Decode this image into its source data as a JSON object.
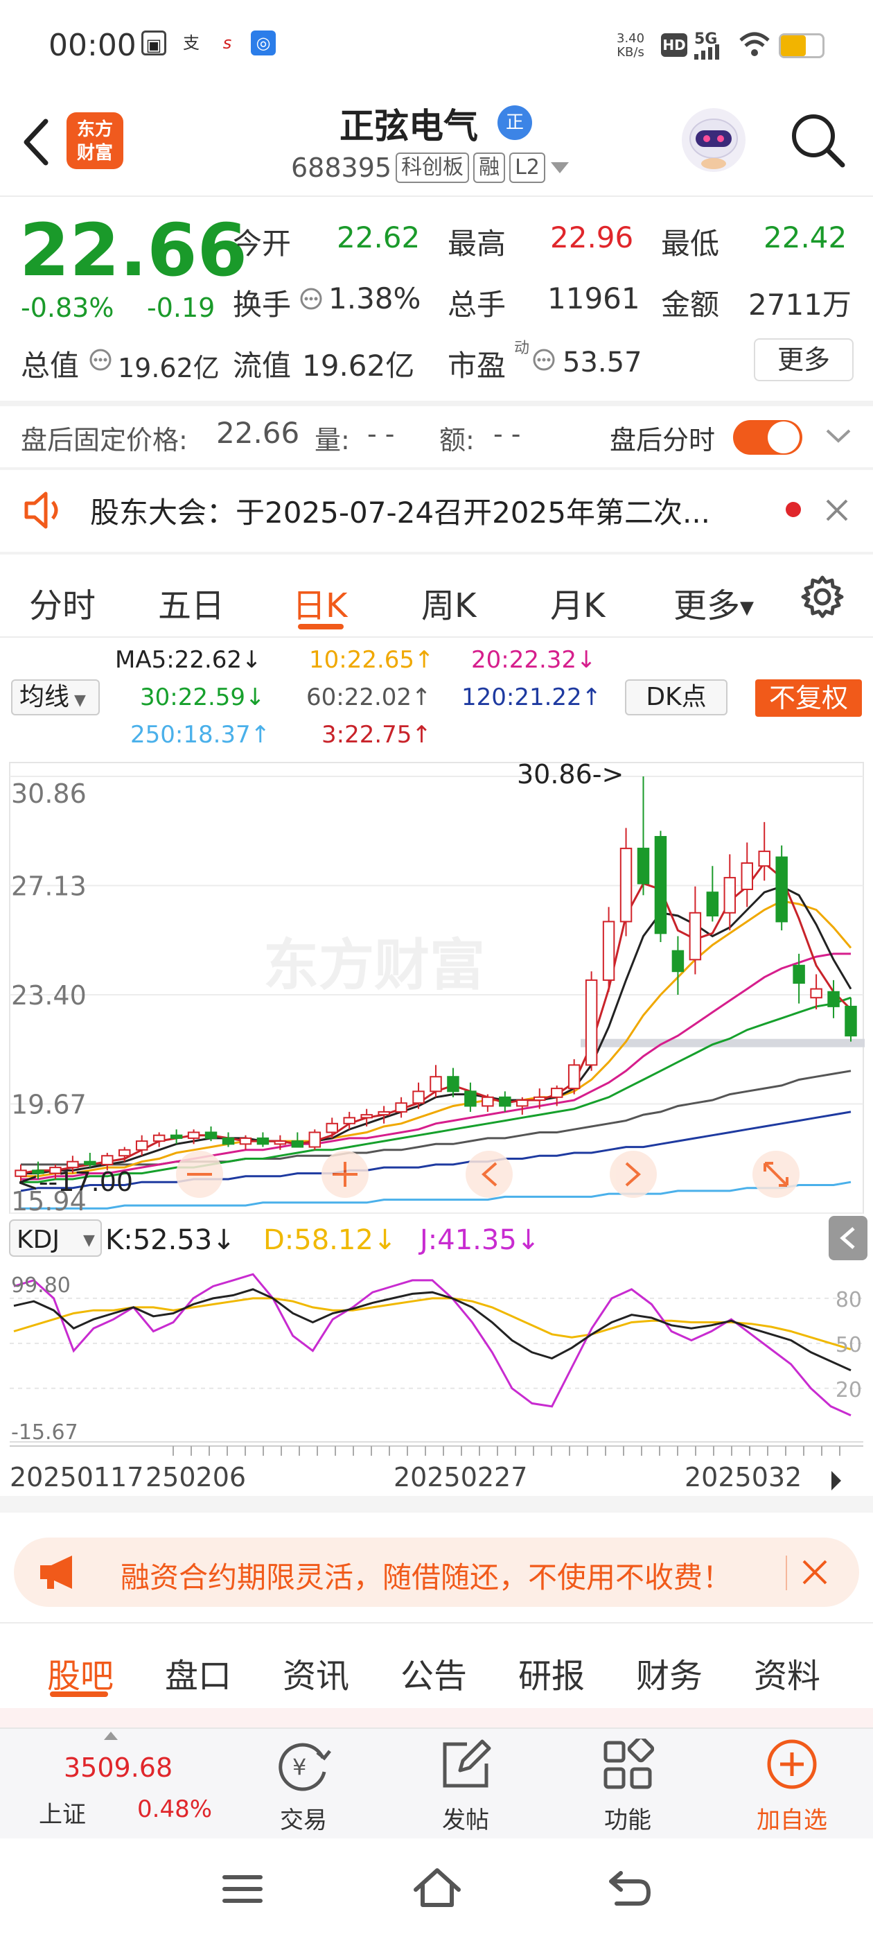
{
  "status_bar": {
    "time": "00:00",
    "net_speed": "3.40",
    "net_speed_unit": "KB/s",
    "network": "5G",
    "icons": [
      "hd-icon",
      "signal-icon",
      "wifi-icon",
      "battery-icon"
    ]
  },
  "header": {
    "logo_line1": "东方",
    "logo_line2": "财富",
    "stock_name": "正弦电气",
    "name_badge": "正",
    "stock_code": "688395",
    "tags": [
      "科创板",
      "融",
      "L2"
    ]
  },
  "quote": {
    "price": "22.66",
    "change_pct": "-0.83%",
    "change_abs": "-0.19",
    "open_label": "今开",
    "open": "22.62",
    "high_label": "最高",
    "high": "22.96",
    "low_label": "最低",
    "low": "22.42",
    "turnover_label": "换手",
    "turnover": "1.38%",
    "volume_label": "总手",
    "volume": "11961",
    "amount_label": "金额",
    "amount": "2711万",
    "mktcap_label": "总值",
    "mktcap": "19.62亿",
    "float_label": "流值",
    "float_cap": "19.62亿",
    "pe_label": "市盈",
    "pe_sup": "动",
    "pe": "53.57",
    "more_label": "更多"
  },
  "after_hours": {
    "label": "盘后固定价格:",
    "price": "22.66",
    "vol_label": "量:",
    "vol": "- -",
    "amt_label": "额:",
    "amt": "- -",
    "toggle_label": "盘后分时",
    "toggle_on": true
  },
  "notice": {
    "text": "股东大会：于2025-07-24召开2025年第二次..."
  },
  "period_tabs": [
    "分时",
    "五日",
    "日K",
    "周K",
    "月K",
    "更多"
  ],
  "ma_legend": {
    "select_label": "均线",
    "ma5": "MA5:22.62↓",
    "ma10": "10:22.65↑",
    "ma20": "20:22.32↓",
    "ma30": "30:22.59↓",
    "ma60": "60:22.02↑",
    "ma120": "120:21.22↑",
    "ma250": "250:18.37↑",
    "ma3": "3:22.75↑",
    "dk_label": "DK点",
    "fq_label": "不复权",
    "colors": {
      "ma5": "#222222",
      "ma10": "#f0a800",
      "ma20": "#d61e8c",
      "ma30": "#16a02c",
      "ma60": "#555555",
      "ma120": "#1e3aa0",
      "ma250": "#4ab0ea",
      "ma3": "#c8232a"
    }
  },
  "chart_data": {
    "type": "candlestick",
    "ylim": [
      15.94,
      30.86
    ],
    "y_ticks": [
      "30.86",
      "27.13",
      "23.40",
      "19.67",
      "15.94"
    ],
    "high_label": "30.86->",
    "low_label": "<--17.00",
    "watermark": "东方财富",
    "candles": [
      {
        "o": 17.2,
        "h": 17.6,
        "l": 17.0,
        "c": 17.4
      },
      {
        "o": 17.4,
        "h": 17.7,
        "l": 17.1,
        "c": 17.3
      },
      {
        "o": 17.3,
        "h": 17.6,
        "l": 17.1,
        "c": 17.5
      },
      {
        "o": 17.5,
        "h": 17.9,
        "l": 17.3,
        "c": 17.7
      },
      {
        "o": 17.7,
        "h": 18.0,
        "l": 17.5,
        "c": 17.6
      },
      {
        "o": 17.6,
        "h": 18.0,
        "l": 17.4,
        "c": 17.9
      },
      {
        "o": 17.9,
        "h": 18.2,
        "l": 17.7,
        "c": 18.1
      },
      {
        "o": 18.1,
        "h": 18.6,
        "l": 17.9,
        "c": 18.4
      },
      {
        "o": 18.4,
        "h": 18.7,
        "l": 18.2,
        "c": 18.6
      },
      {
        "o": 18.6,
        "h": 18.8,
        "l": 18.3,
        "c": 18.5
      },
      {
        "o": 18.5,
        "h": 18.8,
        "l": 18.3,
        "c": 18.7
      },
      {
        "o": 18.7,
        "h": 18.9,
        "l": 18.4,
        "c": 18.5
      },
      {
        "o": 18.5,
        "h": 18.7,
        "l": 18.2,
        "c": 18.3
      },
      {
        "o": 18.3,
        "h": 18.6,
        "l": 18.1,
        "c": 18.5
      },
      {
        "o": 18.5,
        "h": 18.7,
        "l": 18.2,
        "c": 18.3
      },
      {
        "o": 18.3,
        "h": 18.6,
        "l": 18.1,
        "c": 18.4
      },
      {
        "o": 18.4,
        "h": 18.7,
        "l": 18.2,
        "c": 18.2
      },
      {
        "o": 18.2,
        "h": 18.8,
        "l": 18.1,
        "c": 18.7
      },
      {
        "o": 18.7,
        "h": 19.2,
        "l": 18.5,
        "c": 19.0
      },
      {
        "o": 19.0,
        "h": 19.4,
        "l": 18.8,
        "c": 19.2
      },
      {
        "o": 19.2,
        "h": 19.5,
        "l": 18.9,
        "c": 19.3
      },
      {
        "o": 19.3,
        "h": 19.6,
        "l": 19.0,
        "c": 19.4
      },
      {
        "o": 19.4,
        "h": 19.9,
        "l": 19.2,
        "c": 19.7
      },
      {
        "o": 19.7,
        "h": 20.4,
        "l": 19.5,
        "c": 20.1
      },
      {
        "o": 20.1,
        "h": 21.0,
        "l": 19.9,
        "c": 20.6
      },
      {
        "o": 20.6,
        "h": 20.9,
        "l": 19.9,
        "c": 20.1
      },
      {
        "o": 20.1,
        "h": 20.4,
        "l": 19.4,
        "c": 19.6
      },
      {
        "o": 19.6,
        "h": 20.0,
        "l": 19.4,
        "c": 19.9
      },
      {
        "o": 19.9,
        "h": 20.1,
        "l": 19.4,
        "c": 19.6
      },
      {
        "o": 19.6,
        "h": 19.9,
        "l": 19.3,
        "c": 19.8
      },
      {
        "o": 19.8,
        "h": 20.2,
        "l": 19.5,
        "c": 19.9
      },
      {
        "o": 19.9,
        "h": 20.3,
        "l": 19.6,
        "c": 20.2
      },
      {
        "o": 20.2,
        "h": 21.2,
        "l": 20.0,
        "c": 21.0
      },
      {
        "o": 21.0,
        "h": 24.2,
        "l": 20.8,
        "c": 23.9
      },
      {
        "o": 23.9,
        "h": 26.4,
        "l": 23.5,
        "c": 25.9
      },
      {
        "o": 25.9,
        "h": 29.1,
        "l": 25.4,
        "c": 28.4
      },
      {
        "o": 28.4,
        "h": 30.86,
        "l": 26.8,
        "c": 27.2
      },
      {
        "o": 28.8,
        "h": 29.0,
        "l": 25.2,
        "c": 25.5
      },
      {
        "o": 24.9,
        "h": 25.4,
        "l": 23.4,
        "c": 24.2
      },
      {
        "o": 24.6,
        "h": 27.1,
        "l": 24.1,
        "c": 26.2
      },
      {
        "o": 26.9,
        "h": 27.8,
        "l": 25.9,
        "c": 26.1
      },
      {
        "o": 26.2,
        "h": 28.2,
        "l": 25.6,
        "c": 27.4
      },
      {
        "o": 27.0,
        "h": 28.6,
        "l": 26.4,
        "c": 27.9
      },
      {
        "o": 27.8,
        "h": 29.3,
        "l": 27.3,
        "c": 28.3
      },
      {
        "o": 28.1,
        "h": 28.5,
        "l": 25.6,
        "c": 25.9
      },
      {
        "o": 24.4,
        "h": 24.8,
        "l": 23.1,
        "c": 23.8
      },
      {
        "o": 23.3,
        "h": 24.1,
        "l": 22.9,
        "c": 23.6
      },
      {
        "o": 23.5,
        "h": 23.9,
        "l": 22.6,
        "c": 23.0
      },
      {
        "o": 23.0,
        "h": 23.3,
        "l": 21.8,
        "c": 22.0
      }
    ],
    "ma_series": {
      "ma3": [
        17.3,
        17.4,
        17.4,
        17.5,
        17.6,
        17.7,
        17.8,
        18.1,
        18.4,
        18.5,
        18.6,
        18.6,
        18.5,
        18.4,
        18.4,
        18.4,
        18.3,
        18.4,
        18.6,
        19.0,
        19.2,
        19.3,
        19.5,
        19.7,
        20.1,
        20.3,
        20.1,
        19.9,
        19.7,
        19.8,
        19.8,
        20.0,
        20.4,
        21.7,
        23.6,
        26.1,
        27.2,
        27.0,
        25.6,
        25.3,
        25.5,
        26.6,
        27.1,
        27.9,
        27.4,
        26.0,
        24.4,
        23.5,
        22.9
      ],
      "ma5": [
        17.3,
        17.3,
        17.4,
        17.4,
        17.5,
        17.6,
        17.7,
        17.9,
        18.1,
        18.3,
        18.4,
        18.5,
        18.5,
        18.5,
        18.4,
        18.4,
        18.3,
        18.4,
        18.5,
        18.8,
        19.0,
        19.2,
        19.4,
        19.6,
        19.9,
        20.0,
        20.0,
        19.9,
        19.8,
        19.8,
        19.8,
        19.9,
        20.2,
        21.0,
        22.3,
        23.9,
        25.4,
        26.2,
        26.1,
        25.8,
        25.4,
        25.7,
        26.3,
        26.9,
        27.1,
        26.8,
        25.8,
        24.6,
        23.6
      ],
      "ma10": [
        17.2,
        17.2,
        17.3,
        17.3,
        17.4,
        17.5,
        17.5,
        17.7,
        17.8,
        18.0,
        18.1,
        18.2,
        18.3,
        18.4,
        18.4,
        18.4,
        18.4,
        18.4,
        18.5,
        18.6,
        18.7,
        18.9,
        19.0,
        19.2,
        19.4,
        19.6,
        19.7,
        19.8,
        19.8,
        19.8,
        19.9,
        19.9,
        20.1,
        20.5,
        21.1,
        21.8,
        22.7,
        23.4,
        24.0,
        24.6,
        25.1,
        25.5,
        25.9,
        26.3,
        26.6,
        26.5,
        26.3,
        25.7,
        25.0
      ],
      "ma20": [
        17.1,
        17.1,
        17.2,
        17.2,
        17.3,
        17.3,
        17.4,
        17.5,
        17.6,
        17.7,
        17.8,
        17.9,
        18.0,
        18.1,
        18.1,
        18.2,
        18.3,
        18.3,
        18.4,
        18.5,
        18.5,
        18.6,
        18.7,
        18.8,
        19.0,
        19.1,
        19.2,
        19.3,
        19.4,
        19.5,
        19.6,
        19.7,
        19.8,
        20.1,
        20.4,
        20.8,
        21.3,
        21.7,
        22.0,
        22.4,
        22.8,
        23.2,
        23.6,
        24.0,
        24.3,
        24.5,
        24.7,
        24.8,
        24.8
      ],
      "ma30": [
        17.0,
        17.0,
        17.1,
        17.1,
        17.2,
        17.2,
        17.3,
        17.3,
        17.4,
        17.5,
        17.5,
        17.6,
        17.7,
        17.8,
        17.8,
        17.9,
        18.0,
        18.1,
        18.1,
        18.2,
        18.3,
        18.4,
        18.5,
        18.6,
        18.7,
        18.8,
        18.9,
        19.0,
        19.1,
        19.2,
        19.3,
        19.4,
        19.5,
        19.7,
        19.9,
        20.2,
        20.5,
        20.8,
        21.1,
        21.4,
        21.7,
        21.9,
        22.2,
        22.4,
        22.6,
        22.8,
        23.0,
        23.1,
        23.3
      ],
      "ma60": [
        17.6,
        17.6,
        17.6,
        17.6,
        17.6,
        17.6,
        17.6,
        17.6,
        17.6,
        17.7,
        17.7,
        17.7,
        17.7,
        17.8,
        17.8,
        17.8,
        17.9,
        17.9,
        17.9,
        18.0,
        18.0,
        18.1,
        18.1,
        18.2,
        18.3,
        18.3,
        18.4,
        18.5,
        18.5,
        18.6,
        18.7,
        18.7,
        18.8,
        18.9,
        19.0,
        19.1,
        19.3,
        19.4,
        19.6,
        19.7,
        19.8,
        20.0,
        20.1,
        20.2,
        20.3,
        20.5,
        20.6,
        20.7,
        20.8
      ],
      "ma120": [
        16.7,
        16.8,
        16.8,
        16.8,
        16.9,
        16.9,
        16.9,
        17.0,
        17.0,
        17.0,
        17.1,
        17.1,
        17.1,
        17.2,
        17.2,
        17.2,
        17.3,
        17.3,
        17.3,
        17.4,
        17.4,
        17.5,
        17.5,
        17.5,
        17.6,
        17.6,
        17.7,
        17.7,
        17.8,
        17.8,
        17.9,
        17.9,
        18.0,
        18.0,
        18.1,
        18.2,
        18.2,
        18.3,
        18.4,
        18.5,
        18.6,
        18.7,
        18.8,
        18.9,
        19.0,
        19.1,
        19.2,
        19.3,
        19.4
      ],
      "ma250": [
        16.1,
        16.1,
        16.1,
        16.1,
        16.1,
        16.1,
        16.2,
        16.2,
        16.2,
        16.2,
        16.2,
        16.2,
        16.2,
        16.2,
        16.3,
        16.3,
        16.3,
        16.3,
        16.3,
        16.3,
        16.3,
        16.4,
        16.4,
        16.4,
        16.4,
        16.4,
        16.4,
        16.4,
        16.5,
        16.5,
        16.5,
        16.5,
        16.5,
        16.5,
        16.6,
        16.6,
        16.6,
        16.6,
        16.7,
        16.7,
        16.7,
        16.7,
        16.8,
        16.8,
        16.8,
        16.9,
        16.9,
        16.9,
        17.0
      ]
    },
    "x_labels": [
      "20250117",
      "250206",
      "20250227",
      "2025032"
    ],
    "kdj": {
      "select_label": "KDJ",
      "k_label": "K:52.53↓",
      "d_label": "D:58.12↓",
      "j_label": "J:41.35↓",
      "ylim": [
        -15.67,
        99.8
      ],
      "y_ticks_left": [
        "99.80",
        "-15.67"
      ],
      "y_ticks_right": [
        "80",
        "50",
        "20"
      ],
      "k": [
        75,
        78,
        72,
        60,
        66,
        70,
        74,
        68,
        70,
        76,
        80,
        82,
        86,
        80,
        70,
        64,
        70,
        73,
        77,
        80,
        83,
        84,
        80,
        74,
        64,
        52,
        44,
        40,
        47,
        56,
        64,
        69,
        67,
        62,
        60,
        62,
        65,
        60,
        56,
        52,
        44,
        38,
        32
      ],
      "d": [
        58,
        62,
        66,
        70,
        72,
        72,
        74,
        74,
        72,
        74,
        76,
        78,
        80,
        80,
        78,
        74,
        72,
        72,
        74,
        76,
        78,
        80,
        80,
        78,
        74,
        68,
        62,
        56,
        54,
        56,
        60,
        64,
        65,
        65,
        64,
        64,
        64,
        63,
        61,
        58,
        54,
        50,
        46
      ],
      "j": [
        88,
        92,
        80,
        45,
        60,
        66,
        74,
        58,
        64,
        80,
        88,
        92,
        96,
        80,
        55,
        45,
        66,
        74,
        84,
        88,
        92,
        92,
        80,
        64,
        44,
        20,
        10,
        8,
        34,
        60,
        80,
        86,
        76,
        58,
        52,
        58,
        66,
        56,
        46,
        36,
        20,
        8,
        2
      ]
    }
  },
  "promo": {
    "text": "融资合约期限灵活，随借随还，不使用不收费！"
  },
  "bottom_tabs": [
    "股吧",
    "盘口",
    "资讯",
    "公告",
    "研报",
    "财务",
    "资料"
  ],
  "toolbar": {
    "index_value": "3509.68",
    "index_name": "上证",
    "index_change": "0.48%",
    "trade_label": "交易",
    "post_label": "发帖",
    "function_label": "功能",
    "watchlist_label": "加自选"
  }
}
